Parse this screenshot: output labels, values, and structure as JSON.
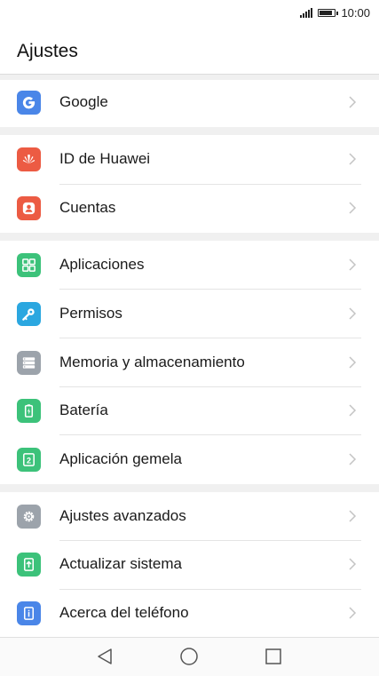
{
  "status": {
    "time": "10:00"
  },
  "header": {
    "title": "Ajustes"
  },
  "items": [
    {
      "label": "Google",
      "icon": "google-icon",
      "color": "#4a86e8"
    },
    {
      "label": "ID de Huawei",
      "icon": "huawei-icon",
      "color": "#ec5b43"
    },
    {
      "label": "Cuentas",
      "icon": "account-icon",
      "color": "#ec5b43"
    },
    {
      "label": "Aplicaciones",
      "icon": "apps-icon",
      "color": "#3cc27a"
    },
    {
      "label": "Permisos",
      "icon": "key-icon",
      "color": "#2ba7e0"
    },
    {
      "label": "Memoria y almacenamiento",
      "icon": "storage-icon",
      "color": "#9ca3ab"
    },
    {
      "label": "Batería",
      "icon": "battery-icon",
      "color": "#3cc27a"
    },
    {
      "label": "Aplicación gemela",
      "icon": "twin-app-icon",
      "color": "#3cc27a"
    },
    {
      "label": "Ajustes avanzados",
      "icon": "gear-icon",
      "color": "#9ca3ab"
    },
    {
      "label": "Actualizar sistema",
      "icon": "update-icon",
      "color": "#3cc27a"
    },
    {
      "label": "Acerca del teléfono",
      "icon": "info-icon",
      "color": "#4a86e8"
    }
  ],
  "navbar": {
    "back_icon": "back-triangle-icon",
    "home_icon": "home-circle-icon",
    "recents_icon": "recents-square-icon"
  }
}
